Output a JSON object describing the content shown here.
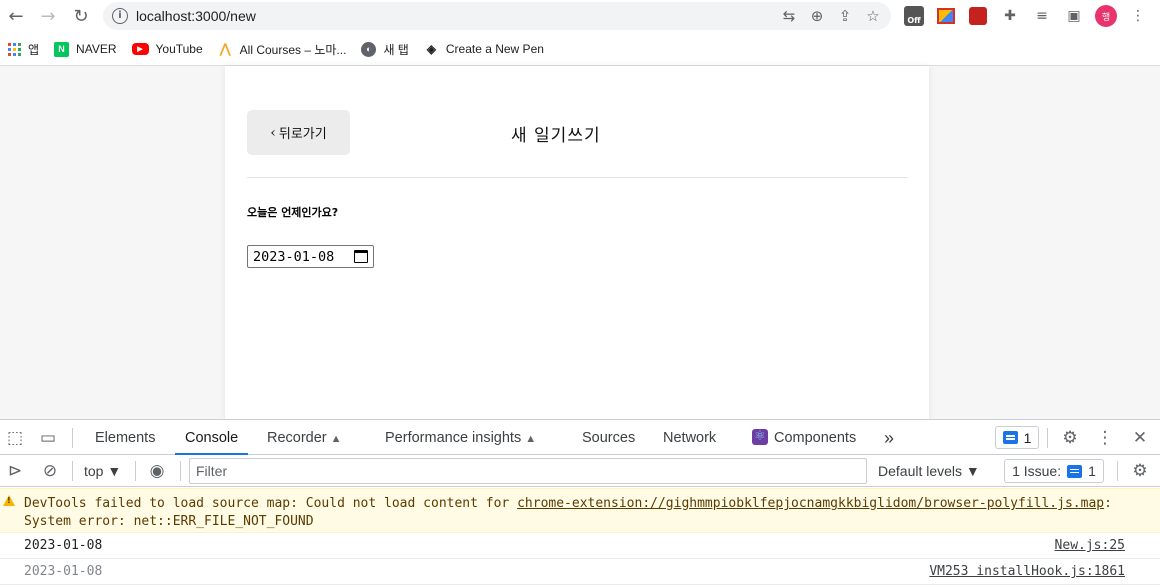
{
  "browser": {
    "url": "localhost:3000/new",
    "extensions": [
      "translate-icon",
      "zoom-icon",
      "share-icon",
      "star-icon",
      "off-extension",
      "color-extension",
      "red-extension",
      "puzzle-icon",
      "media-icon",
      "sidepanel-icon"
    ],
    "profile_initial": "행"
  },
  "bookmarks": [
    {
      "label": "앱",
      "icon": "apps-grid-icon"
    },
    {
      "label": "NAVER",
      "icon": "naver-icon",
      "color": "#03c75a"
    },
    {
      "label": "YouTube",
      "icon": "youtube-icon",
      "color": "#ff0000"
    },
    {
      "label": "All Courses – 노마...",
      "icon": "nomad-icon",
      "color": "#f5a623"
    },
    {
      "label": "새 탭",
      "icon": "globe-icon"
    },
    {
      "label": "Create a New Pen",
      "icon": "codepen-icon"
    }
  ],
  "page": {
    "back_label": "뒤로가기",
    "title": "새 일기쓰기",
    "question": "오늘은 언제인가요?",
    "date_value": "2023-01-08"
  },
  "devtools": {
    "tabs": [
      "Elements",
      "Console",
      "Recorder",
      "Performance insights",
      "Sources",
      "Network",
      "Components"
    ],
    "active_tab": "Console",
    "more": "»",
    "message_count": "1",
    "context": "top ▼",
    "filter_placeholder": "Filter",
    "levels": "Default levels ▼",
    "issues_label": "1 Issue:",
    "issues_count": "1",
    "warning": {
      "prefix": "DevTools failed to load source map: Could not load content for ",
      "link": "chrome-extension://gighmmpiobklfepjocnamgkkbiglidom/browser-polyfill.js.map",
      "suffix": ": System error: net::ERR_FILE_NOT_FOUND"
    },
    "logs": [
      {
        "message": "2023-01-08",
        "source": "New.js:25"
      },
      {
        "message": "2023-01-08",
        "source": "VM253 installHook.js:1861"
      }
    ]
  }
}
